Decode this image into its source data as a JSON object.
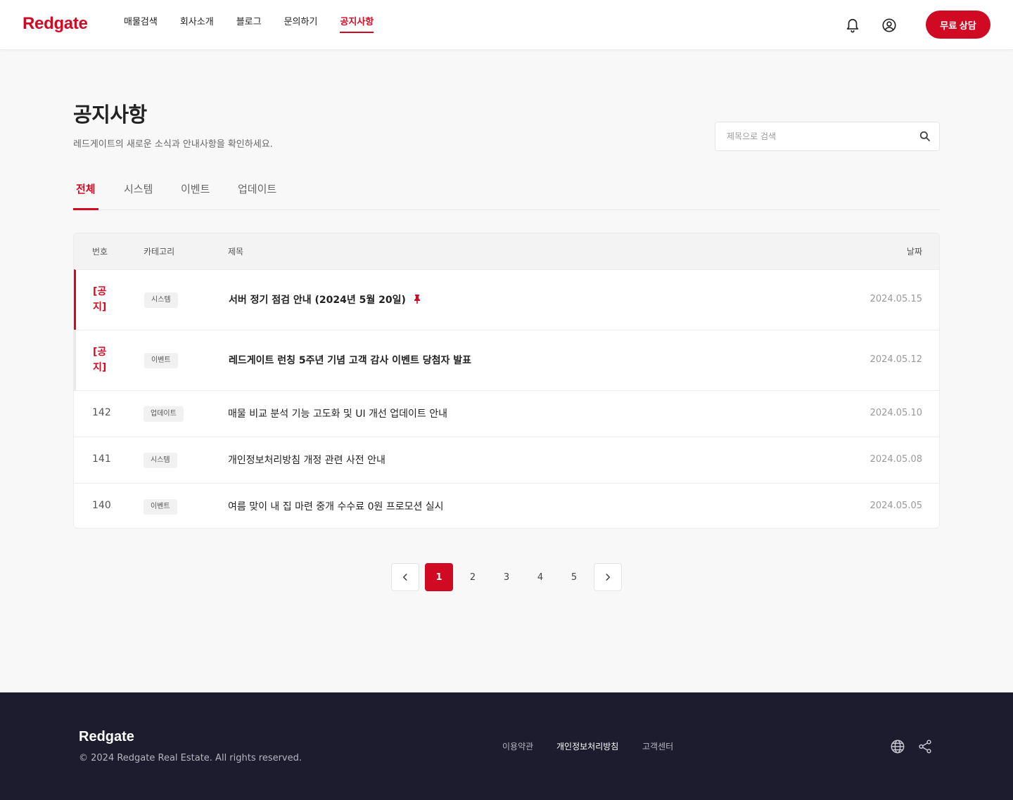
{
  "header": {
    "logo": "Redgate",
    "nav": [
      {
        "label": "매물검색",
        "active": false
      },
      {
        "label": "회사소개",
        "active": false
      },
      {
        "label": "블로그",
        "active": false
      },
      {
        "label": "문의하기",
        "active": false
      },
      {
        "label": "공지사항",
        "active": true
      }
    ],
    "icons": [
      "bell-icon",
      "account-circle-icon"
    ],
    "cta_label": "무료 상담"
  },
  "page": {
    "title": "공지사항",
    "subtitle": "레드게이트의 새로운 소식과 안내사항을 확인하세요.",
    "search_placeholder": "제목으로 검색",
    "search_value": ""
  },
  "tabs": [
    {
      "label": "전체",
      "active": true
    },
    {
      "label": "시스템",
      "active": false
    },
    {
      "label": "이벤트",
      "active": false
    },
    {
      "label": "업데이트",
      "active": false
    }
  ],
  "table": {
    "headers": {
      "number": "번호",
      "category": "카테고리",
      "title": "제목",
      "date": "날짜"
    },
    "rows": [
      {
        "number": "[공지]",
        "category": "시스템",
        "title": "서버 정기 점검 안내 (2024년 5월 20일)",
        "date": "2024.05.15",
        "notice": true,
        "pinned": true
      },
      {
        "number": "[공지]",
        "category": "이벤트",
        "title": "레드게이트 런칭 5주년 기념 고객 감사 이벤트 당첨자 발표",
        "date": "2024.05.12",
        "notice": true,
        "pinned": false
      },
      {
        "number": "142",
        "category": "업데이트",
        "title": "매물 비교 분석 기능 고도화 및 UI 개선 업데이트 안내",
        "date": "2024.05.10",
        "notice": false,
        "pinned": false
      },
      {
        "number": "141",
        "category": "시스템",
        "title": "개인정보처리방침 개정 관련 사전 안내",
        "date": "2024.05.08",
        "notice": false,
        "pinned": false
      },
      {
        "number": "140",
        "category": "이벤트",
        "title": "여름 맞이 내 집 마련 중개 수수료 0원 프로모션 실시",
        "date": "2024.05.05",
        "notice": false,
        "pinned": false
      }
    ]
  },
  "pagination": {
    "pages": [
      "1",
      "2",
      "3",
      "4",
      "5"
    ],
    "current": "1"
  },
  "footer": {
    "logo": "Redgate",
    "copyright": "© 2024 Redgate Real Estate. All rights reserved.",
    "links": [
      {
        "label": "이용약관",
        "emphasis": false
      },
      {
        "label": "개인정보처리방침",
        "emphasis": true
      },
      {
        "label": "고객센터",
        "emphasis": false
      }
    ],
    "icons": [
      "globe-icon",
      "share-icon"
    ]
  },
  "colors": {
    "brand": "#d10a24",
    "footer_bg": "#1c1c2e",
    "page_bg": "#f8f8f8"
  }
}
